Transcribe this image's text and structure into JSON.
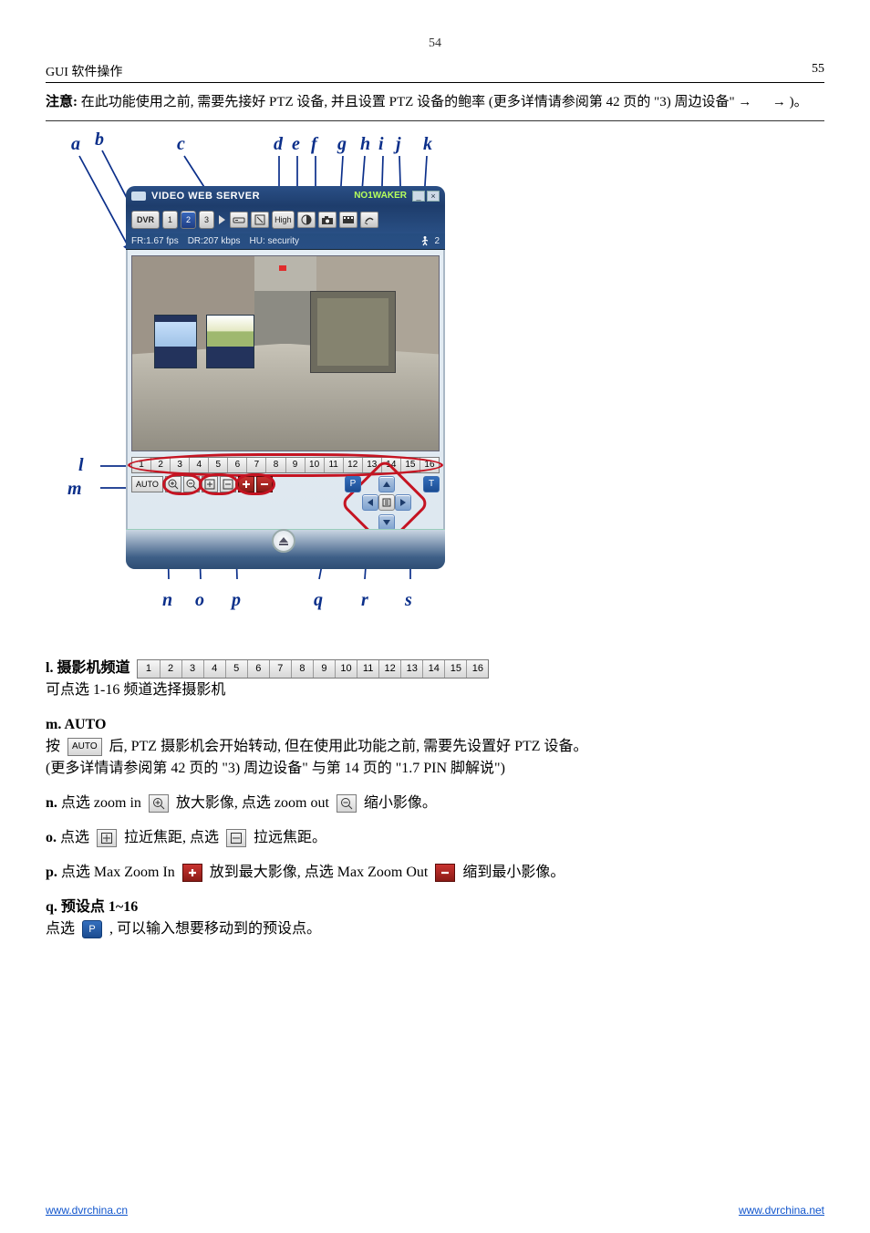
{
  "page_number": "54",
  "header": {
    "left": "GUI 软件操作",
    "right": "55"
  },
  "note": {
    "label": "注意:",
    "text_a": "在此功能使用之前, 需要先接好 PTZ 设备, 并且设置 PTZ 设备的鲍率 (更多详情请参阅第 42 页的 \"3) 周边设备\"",
    "text_b": ")。"
  },
  "app": {
    "title": "VIDEO WEB SERVER",
    "connected": "NO1WAKER",
    "dvr_btn": "DVR",
    "group_btns": [
      "1",
      "2",
      "3"
    ],
    "high_btn": "High",
    "status": {
      "fr": "FR:1.67 fps",
      "dr": "DR:207 kbps",
      "hu": "HU: security",
      "online": "2"
    },
    "channels": [
      "1",
      "2",
      "3",
      "4",
      "5",
      "6",
      "7",
      "8",
      "9",
      "10",
      "11",
      "12",
      "13",
      "14",
      "15",
      "16"
    ],
    "auto": "AUTO",
    "preset_left": "P",
    "preset_right": "T"
  },
  "callouts": {
    "a": "a",
    "b": "b",
    "c": "c",
    "d": "d",
    "e": "e",
    "f": "f",
    "g": "g",
    "h": "h",
    "i": "i",
    "j": "j",
    "k": "k",
    "l": "l",
    "m": "m",
    "n": "n",
    "o": "o",
    "p": "p",
    "q": "q",
    "r": "r",
    "s": "s"
  },
  "body": {
    "l_label": "l. 摄影机频道",
    "l_text": "可点选 1-16 频道选择摄影机",
    "m_label": "m. AUTO",
    "m_text_a": "按",
    "m_text_b": "后, PTZ 摄影机会开始转动, 但在使用此功能之前, 需要先设置好 PTZ 设备。",
    "m_text_c": "(更多详情请参阅第 42 页的 \"3) 周边设备\" 与第 14 页的 \"1.7 PIN 脚解说\")",
    "n_label": "n.",
    "n_text_a": "点选 zoom in",
    "n_text_b": "放大影像, 点选 zoom out",
    "n_text_c": "缩小影像。",
    "o_label": "o.",
    "o_text_a": "点选",
    "o_text_b": "拉近焦距, 点选",
    "o_text_c": "拉远焦距。",
    "p_label": "p.",
    "p_text_a": "点选 Max Zoom In",
    "p_text_b": "放到最大影像, 点选 Max Zoom Out",
    "p_text_c": "缩到最小影像。",
    "q_label": "q. 预设点 1~16",
    "q_text_a": "点选",
    "q_text_b": ", 可以输入想要移动到的预设点。"
  },
  "arrow": "→",
  "footer": {
    "left": "www.dvrchina.cn",
    "right": "www.dvrchina.net"
  }
}
